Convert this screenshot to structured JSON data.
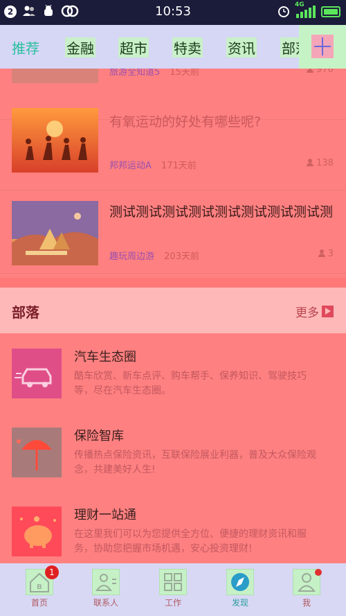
{
  "status_bar": {
    "time": "10:53",
    "notification_count": "2",
    "network": "4G"
  },
  "tabs": [
    {
      "label": "推荐",
      "active": true
    },
    {
      "label": "金融",
      "active": false
    },
    {
      "label": "超市",
      "active": false
    },
    {
      "label": "特卖",
      "active": false
    },
    {
      "label": "资讯",
      "active": false
    },
    {
      "label": "部落",
      "active": false
    }
  ],
  "news": [
    {
      "title": "",
      "source": "旅游全知道5",
      "time": "15天前",
      "views": "970"
    },
    {
      "title": "有氧运动的好处有哪些呢?",
      "source": "邦邦运动A",
      "time": "171天前",
      "views": "138"
    },
    {
      "title": "测试测试测试测试测试测试测试测试测试测试",
      "source": "趣玩周边游",
      "time": "203天前",
      "views": "3"
    }
  ],
  "tribe_section": {
    "title": "部落",
    "more": "更多"
  },
  "tribes": [
    {
      "name": "汽车生态圈",
      "desc": "酷车欣赏、新车点评、购车帮手、保养知识、驾驶技巧等，尽在汽车生态圈。"
    },
    {
      "name": "保险智库",
      "desc": "传播热点保险资讯，互联保险展业利器，普及大众保险观念，共建美好人生!"
    },
    {
      "name": "理财一站通",
      "desc": "在这里我们可以为您提供全方位、便捷的理财资讯和服务，协助您把握市场机遇，安心投资理财!"
    }
  ],
  "bottom_nav": [
    {
      "label": "首页",
      "badge": "1"
    },
    {
      "label": "联系人"
    },
    {
      "label": "工作"
    },
    {
      "label": "发现",
      "active": true
    },
    {
      "label": "我"
    }
  ],
  "colors": {
    "accent": "#2bbf9f",
    "overlay_red": "#ff8080",
    "badge_red": "#e02020"
  }
}
